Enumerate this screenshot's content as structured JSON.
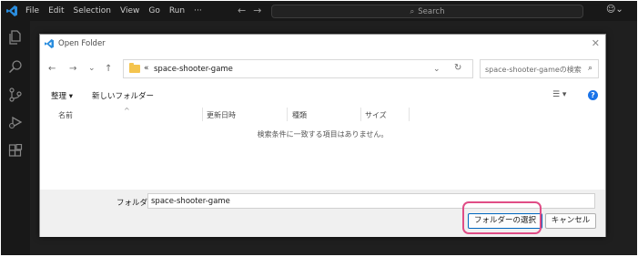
{
  "menu": [
    "File",
    "Edit",
    "Selection",
    "View",
    "Go",
    "Run",
    "···"
  ],
  "search": {
    "label": "Search"
  },
  "dialog": {
    "title": "Open Folder",
    "address": {
      "chevron": "«",
      "path": "space-shooter-game"
    },
    "search_placeholder": "space-shooter-gameの検索",
    "toolbar": {
      "organize": "整理 ▾",
      "new_folder": "新しいフォルダー"
    },
    "columns": [
      "名前",
      "更新日時",
      "種類",
      "サイズ"
    ],
    "empty_message": "検索条件に一致する項目はありません。",
    "folder_label": "フォルダー:",
    "folder_value": "space-shooter-game",
    "select_button": "フォルダーの選択",
    "cancel_button": "キャンセル"
  },
  "colors": {
    "highlight": "#e04d86",
    "accent": "#0067c0",
    "vscode_blue": "#2a8dde"
  }
}
